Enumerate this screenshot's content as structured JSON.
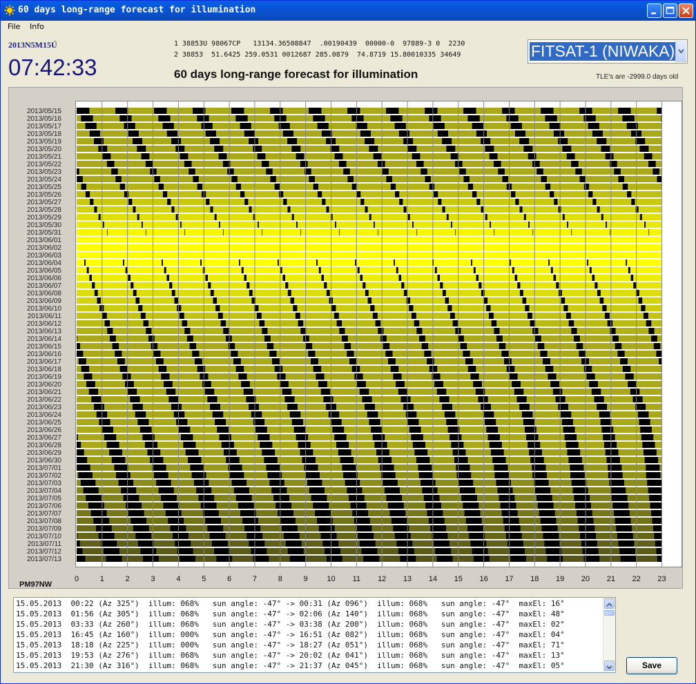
{
  "window": {
    "title": "60 days long-range forecast for illumination",
    "controls": [
      "minimize",
      "maximize",
      "close"
    ]
  },
  "menu": {
    "file": "File",
    "info": "Info"
  },
  "header": {
    "date_text": "2013N5M15Ú",
    "clock": "07:42:33",
    "tle_line1": "1 38853U 98067CP   13134.36508847  .00190439  00000-0  97889-3 0  2230",
    "tle_line2": "2 38853  51.6425 259.0531 0012687 285.0879  74.8719 15.80010335 34649",
    "heading": "60 days long-range forecast for illumination",
    "tle_age": "TLE's are -2999.0 days old",
    "satellite": "FITSAT-1 (NIWAKA)"
  },
  "chart_data": {
    "type": "heatmap",
    "dates": [
      "2013/05/15",
      "2013/05/16",
      "2013/05/17",
      "2013/05/18",
      "2013/05/19",
      "2013/05/20",
      "2013/05/21",
      "2013/05/22",
      "2013/05/23",
      "2013/05/24",
      "2013/05/25",
      "2013/05/26",
      "2013/05/27",
      "2013/05/28",
      "2013/05/29",
      "2013/05/30",
      "2013/05/31",
      "2013/06/01",
      "2013/06/02",
      "2013/06/03",
      "2013/06/04",
      "2013/06/05",
      "2013/06/06",
      "2013/06/07",
      "2013/06/08",
      "2013/06/09",
      "2013/06/10",
      "2013/06/11",
      "2013/06/12",
      "2013/06/13",
      "2013/06/14",
      "2013/06/15",
      "2013/06/16",
      "2013/06/17",
      "2013/06/18",
      "2013/06/19",
      "2013/06/20",
      "2013/06/21",
      "2013/06/22",
      "2013/06/23",
      "2013/06/24",
      "2013/06/25",
      "2013/06/26",
      "2013/06/27",
      "2013/06/28",
      "2013/06/29",
      "2013/06/30",
      "2013/07/01",
      "2013/07/02",
      "2013/07/03",
      "2013/07/04",
      "2013/07/05",
      "2013/07/06",
      "2013/07/07",
      "2013/07/08",
      "2013/07/09",
      "2013/07/10",
      "2013/07/11",
      "2013/07/12",
      "2013/07/13"
    ],
    "hours": [
      "0",
      "1",
      "2",
      "3",
      "4",
      "5",
      "6",
      "7",
      "8",
      "9",
      "10",
      "11",
      "12",
      "13",
      "14",
      "15",
      "16",
      "17",
      "18",
      "19",
      "20",
      "21",
      "22",
      "23"
    ],
    "orbit_period_h": 1.52,
    "colors": {
      "sunlit_dark": "#a9a91b",
      "sunlit_bright": "#ffff00",
      "sunlit_late": "#55551a",
      "eclipse": "#000000"
    },
    "location": "PM97NW"
  },
  "passes": [
    "15.05.2013  00:22 (Az 325°)  illum: 068%   sun angle: -47° -> 00:31 (Az 096°)  illum: 068%   sun angle: -47°  maxEl: 16°",
    "15.05.2013  01:56 (Az 305°)  illum: 068%   sun angle: -47° -> 02:06 (Az 140°)  illum: 068%   sun angle: -47°  maxEl: 48°",
    "15.05.2013  03:33 (Az 260°)  illum: 068%   sun angle: -47° -> 03:38 (Az 200°)  illum: 068%   sun angle: -47°  maxEl: 02°",
    "15.05.2013  16:45 (Az 160°)  illum: 000%   sun angle: -47° -> 16:51 (Az 082°)  illum: 068%   sun angle: -47°  maxEl: 04°",
    "15.05.2013  18:18 (Az 225°)  illum: 000%   sun angle: -47° -> 18:27 (Az 051°)  illum: 068%   sun angle: -47°  maxEl: 71°",
    "15.05.2013  19:53 (Az 276°)  illum: 068%   sun angle: -47° -> 20:02 (Az 041°)  illum: 068%   sun angle: -47°  maxEl: 13°",
    "15.05.2013  21:30 (Az 316°)  illum: 068%   sun angle: -47° -> 21:37 (Az 045°)  illum: 068%   sun angle: -47°  maxEl: 05°"
  ],
  "save_label": "Save"
}
